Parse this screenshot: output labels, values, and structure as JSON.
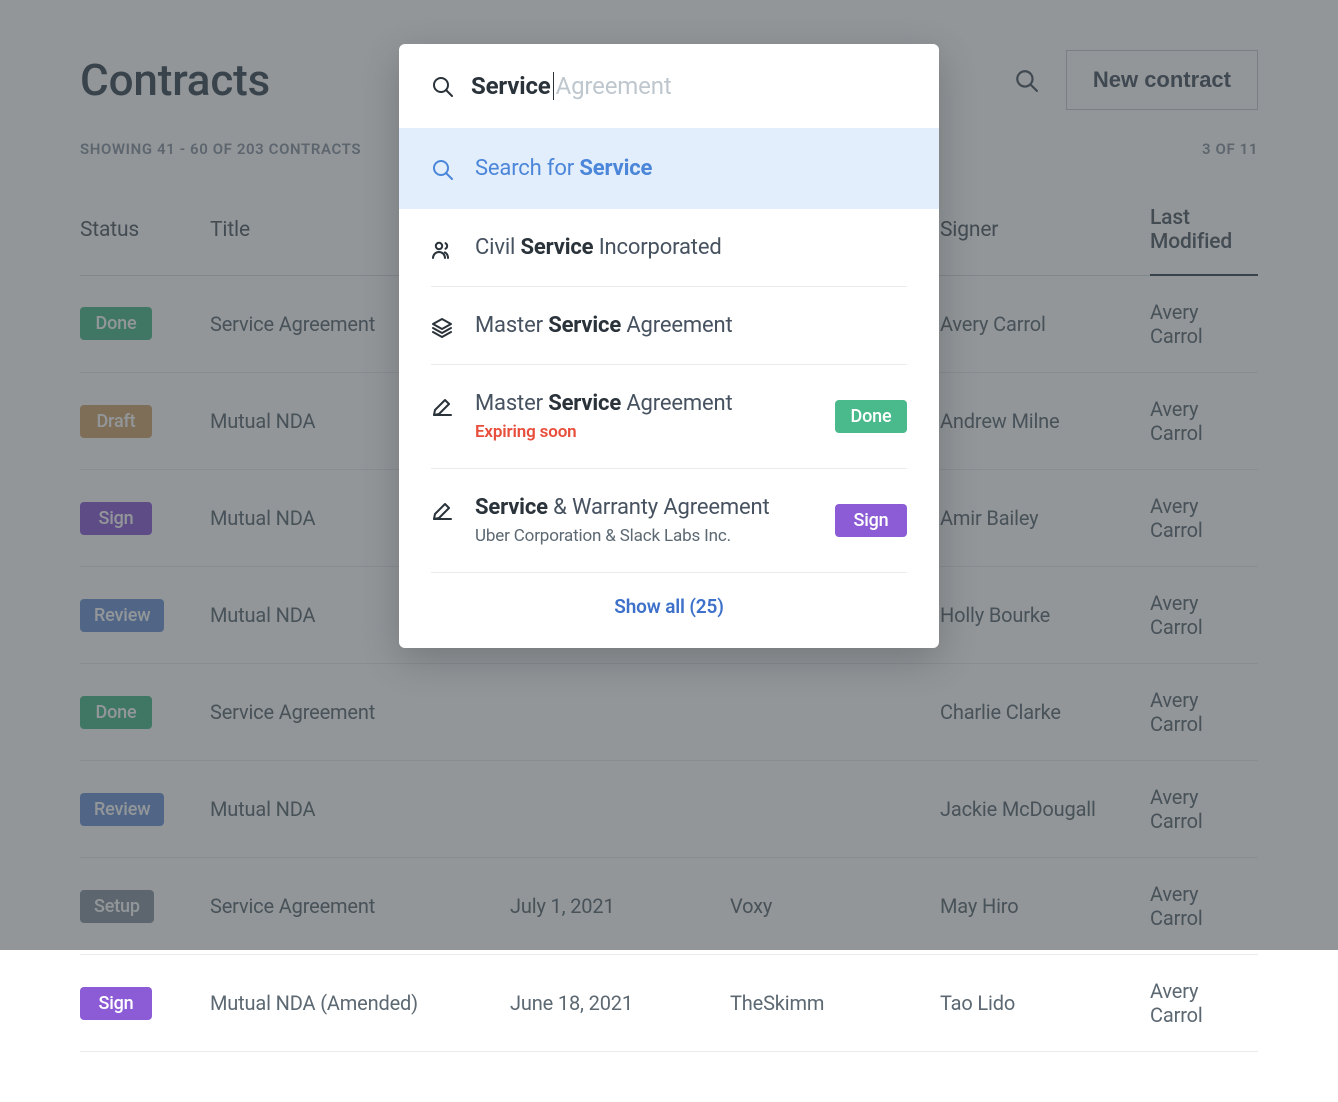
{
  "page": {
    "title": "Contracts",
    "showing_text": "SHOWING 41 - 60 OF 203 CONTRACTS",
    "page_indicator": "3 OF 11",
    "new_contract_label": "New contract"
  },
  "columns": {
    "status": "Status",
    "title": "Title",
    "date": "",
    "party": "",
    "signer": "Signer",
    "last_modified": "Last Modified"
  },
  "rows": [
    {
      "status": "Done",
      "status_class": "done",
      "title": "Service Agreement",
      "date": "",
      "party": "",
      "signer": "Avery Carrol",
      "last_modified": "Avery Carrol"
    },
    {
      "status": "Draft",
      "status_class": "draft",
      "title": "Mutual NDA",
      "date": "",
      "party": "",
      "signer": "Andrew Milne",
      "last_modified": "Avery Carrol"
    },
    {
      "status": "Sign",
      "status_class": "sign",
      "title": "Mutual NDA",
      "date": "",
      "party": "",
      "signer": "Amir Bailey",
      "last_modified": "Avery Carrol"
    },
    {
      "status": "Review",
      "status_class": "review",
      "title": "Mutual NDA",
      "date": "",
      "party": "",
      "signer": "Holly Bourke",
      "last_modified": "Avery Carrol"
    },
    {
      "status": "Done",
      "status_class": "done",
      "title": "Service Agreement",
      "date": "",
      "party": "",
      "signer": "Charlie Clarke",
      "last_modified": "Avery Carrol"
    },
    {
      "status": "Review",
      "status_class": "review",
      "title": "Mutual NDA",
      "date": "",
      "party": "",
      "signer": "Jackie McDougall",
      "last_modified": "Avery Carrol"
    },
    {
      "status": "Setup",
      "status_class": "setup",
      "title": "Service Agreement",
      "date": "July 1, 2021",
      "party": "Voxy",
      "signer": "May Hiro",
      "last_modified": "Avery Carrol"
    },
    {
      "status": "Sign",
      "status_class": "sign",
      "title": "Mutual NDA (Amended)",
      "date": "June 18, 2021",
      "party": "TheSkimm",
      "signer": "Tao Lido",
      "last_modified": "Avery Carrol"
    }
  ],
  "search": {
    "typed": "Service",
    "suggestion_rest": " Agreement",
    "search_for_prefix": "Search for ",
    "search_for_bold": "Service",
    "show_all": "Show all (25)",
    "results": [
      {
        "icon": "people",
        "pre": "Civil ",
        "bold": "Service",
        "post": " Incorporated",
        "sub": "",
        "sub_class": "",
        "badge": "",
        "badge_class": ""
      },
      {
        "icon": "stack",
        "pre": "Master ",
        "bold": "Service",
        "post": " Agreement",
        "sub": "",
        "sub_class": "",
        "badge": "",
        "badge_class": ""
      },
      {
        "icon": "edit",
        "pre": "Master ",
        "bold": "Service",
        "post": " Agreement",
        "sub": "Expiring soon",
        "sub_class": "warn",
        "badge": "Done",
        "badge_class": "done"
      },
      {
        "icon": "edit",
        "pre": "",
        "bold": "Service",
        "post": " & Warranty Agreement",
        "sub": "Uber Corporation & Slack Labs Inc.",
        "sub_class": "",
        "badge": "Sign",
        "badge_class": "sign"
      }
    ]
  }
}
